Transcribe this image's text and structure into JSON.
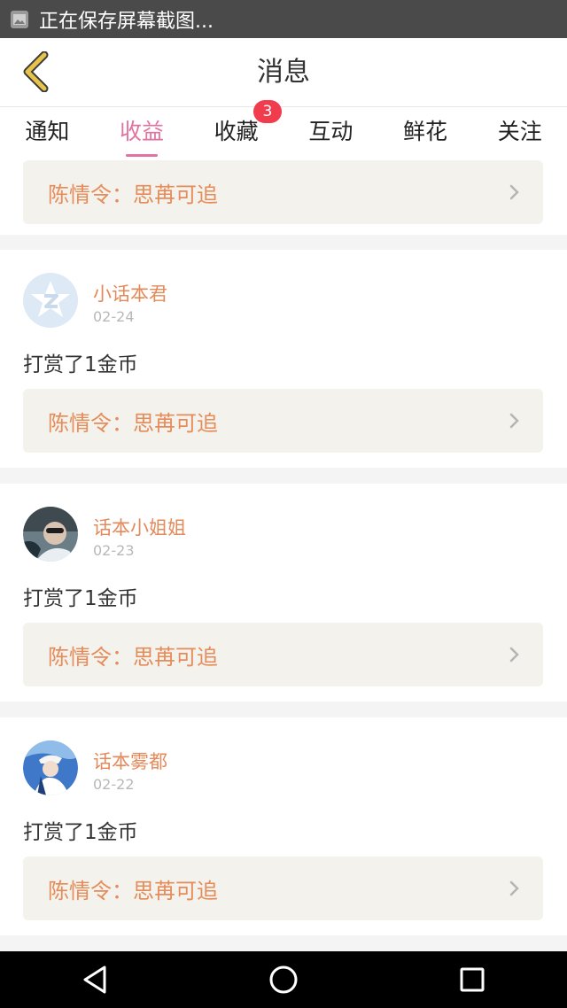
{
  "status_bar": {
    "notification_text": "正在保存屏幕截图..."
  },
  "header": {
    "title": "消息"
  },
  "tabs": [
    {
      "label": "通知",
      "active": false
    },
    {
      "label": "收益",
      "active": true
    },
    {
      "label": "收藏",
      "active": false,
      "badge": "3"
    },
    {
      "label": "互动",
      "active": false
    },
    {
      "label": "鲜花",
      "active": false
    },
    {
      "label": "关注",
      "active": false
    }
  ],
  "feed": {
    "partial_top": {
      "book_title": "陈情令：思苒可追"
    },
    "items": [
      {
        "username": "小话本君",
        "date": "02-24",
        "action": "打赏了1金币",
        "book_title": "陈情令：思苒可追"
      },
      {
        "username": "话本小姐姐",
        "date": "02-23",
        "action": "打赏了1金币",
        "book_title": "陈情令：思苒可追"
      },
      {
        "username": "话本雾都",
        "date": "02-22",
        "action": "打赏了1金币",
        "book_title": "陈情令：思苒可追"
      }
    ]
  },
  "colors": {
    "accent": "#e2729f",
    "username": "#e38a5b",
    "badge": "#f03c4c",
    "back_icon": "#e7c34a"
  },
  "icons": {
    "back": "chevron-left-icon",
    "nav": [
      "back-triangle-icon",
      "home-circle-icon",
      "recents-square-icon"
    ]
  }
}
